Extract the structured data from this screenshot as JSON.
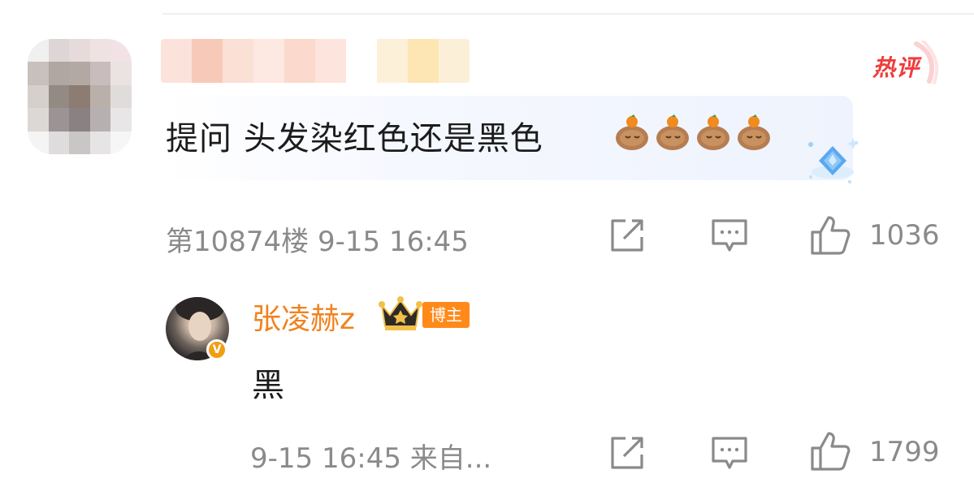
{
  "comment": {
    "hot_label": "热评",
    "text": "提问 头发染红色还是黑色",
    "emoji_name": "capybara-emoji",
    "emoji_count": 4,
    "floor_time": "第10874楼 9-15 16:45",
    "likes": "1036"
  },
  "reply": {
    "author": "张凌赫z",
    "blogger_tag": "博主",
    "verified_mark": "V",
    "text": "黑",
    "time_source": "9-15 16:45 来自...",
    "likes": "1799"
  },
  "icons": {
    "share": "share-icon",
    "reply": "comment-icon",
    "like": "thumbs-up-icon",
    "crown": "crown-icon",
    "diamond": "diamond-icon"
  },
  "colors": {
    "hot": "#f03c3c",
    "author": "#f0821e",
    "tag": "#ff8a1a",
    "meta": "#8a8a8a"
  }
}
